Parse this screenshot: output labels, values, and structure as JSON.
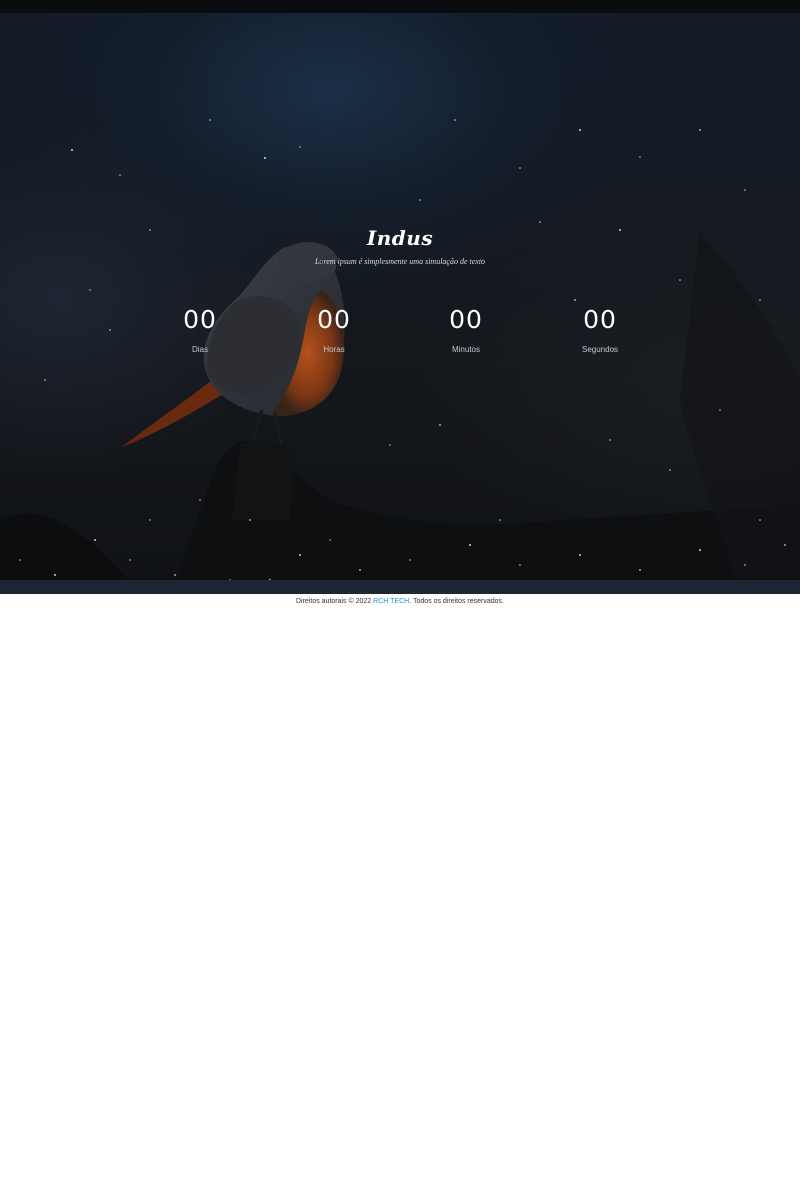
{
  "hero": {
    "title": "Indus",
    "tagline": "Lorem ipsum é simplesmente uma simulação de texto"
  },
  "countdown": {
    "units": [
      {
        "value": "00",
        "label": "Dias"
      },
      {
        "value": "00",
        "label": "Horas"
      },
      {
        "value": "00",
        "label": "Minutos"
      },
      {
        "value": "00",
        "label": "Segundos"
      }
    ]
  },
  "footer": {
    "prefix": "Direitos autorais © 2022",
    "company": "RCH TECH",
    "suffix": ". Todos os direitos reservados."
  },
  "colors": {
    "accent_link": "#1f8fd1",
    "hero_background": "#14181f",
    "bird_breast": "#b5521c"
  }
}
